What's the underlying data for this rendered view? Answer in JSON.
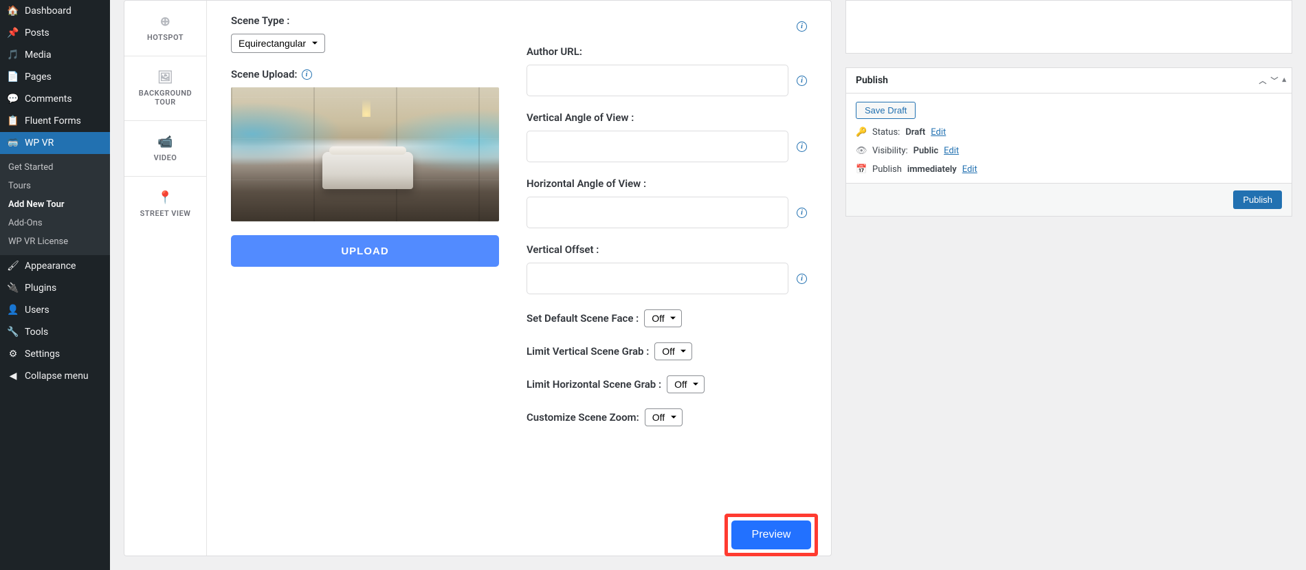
{
  "sidebar": {
    "items": [
      {
        "icon": "◷",
        "label": "Dashboard"
      },
      {
        "icon": "📌",
        "label": "Posts"
      },
      {
        "icon": "🎞",
        "label": "Media"
      },
      {
        "icon": "▤",
        "label": "Pages"
      },
      {
        "icon": "💬",
        "label": "Comments"
      },
      {
        "icon": "▭",
        "label": "Fluent Forms"
      },
      {
        "icon": "▢",
        "label": "WP VR"
      }
    ],
    "submenu": [
      {
        "label": "Get Started"
      },
      {
        "label": "Tours"
      },
      {
        "label": "Add New Tour"
      },
      {
        "label": "Add-Ons"
      },
      {
        "label": "WP VR License"
      }
    ],
    "items2": [
      {
        "icon": "🖌",
        "label": "Appearance"
      },
      {
        "icon": "🔌",
        "label": "Plugins"
      },
      {
        "icon": "👤",
        "label": "Users"
      },
      {
        "icon": "🔧",
        "label": "Tools"
      },
      {
        "icon": "⛶",
        "label": "Settings"
      },
      {
        "icon": "◀",
        "label": "Collapse menu"
      }
    ]
  },
  "tabs": [
    {
      "icon": "⊕",
      "label": "HOTSPOT"
    },
    {
      "icon": "▭",
      "label": "BACKGROUND TOUR"
    },
    {
      "icon": "▭",
      "label": "VIDEO"
    },
    {
      "icon": "📍",
      "label": "STREET VIEW"
    }
  ],
  "left_form": {
    "scene_type_label": "Scene Type :",
    "scene_type_value": "Equirectangular",
    "scene_upload_label": "Scene Upload:",
    "upload_btn": "UPLOAD"
  },
  "right_form": {
    "author_url_label": "Author URL:",
    "vaov_label": "Vertical Angle of View :",
    "haov_label": "Horizontal Angle of View :",
    "voffset_label": "Vertical Offset :",
    "default_face_label": "Set Default Scene Face :",
    "default_face_value": "Off",
    "limit_v_label": "Limit Vertical Scene Grab :",
    "limit_v_value": "Off",
    "limit_h_label": "Limit Horizontal Scene Grab :",
    "limit_h_value": "Off",
    "zoom_label": "Customize Scene Zoom:",
    "zoom_value": "Off",
    "preview_btn": "Preview"
  },
  "publish": {
    "title": "Publish",
    "save_draft": "Save Draft",
    "status_label": "Status: ",
    "status_value": "Draft",
    "visibility_label": "Visibility: ",
    "visibility_value": "Public",
    "schedule_label": "Publish ",
    "schedule_value": "immediately",
    "edit_link": "Edit",
    "publish_btn": "Publish"
  },
  "info_glyph": "i"
}
